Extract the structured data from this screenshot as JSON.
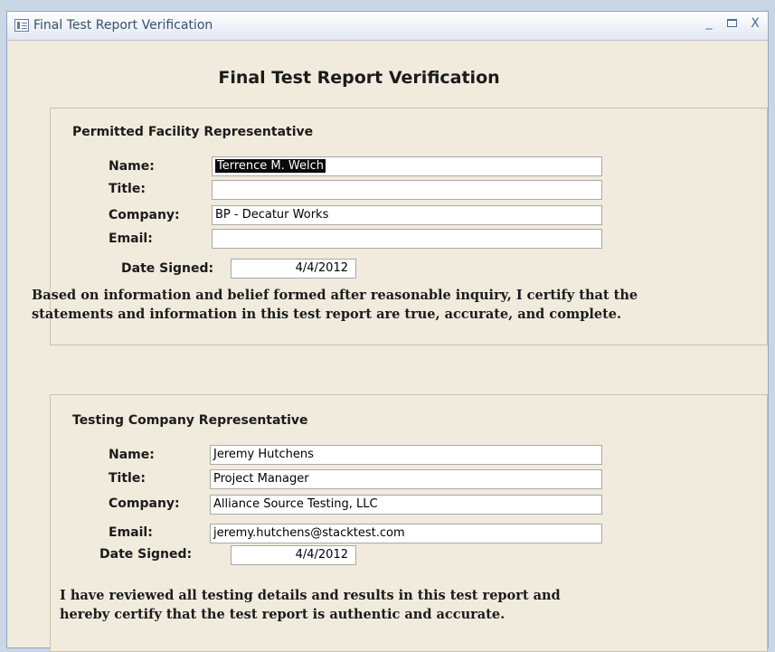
{
  "window": {
    "title": "Final Test Report Verification",
    "controls": {
      "minimize": "_",
      "close": "X"
    }
  },
  "form": {
    "heading": "Final Test Report Verification"
  },
  "facility": {
    "section_title": "Permitted Facility Representative",
    "name_label": "Name:",
    "name_value": "Terrence M. Welch",
    "title_label": "Title:",
    "title_value": "",
    "company_label": "Company:",
    "company_value": "BP - Decatur Works",
    "email_label": "Email:",
    "email_value": "",
    "date_label": "Date Signed:",
    "date_value": "4/4/2012",
    "certification_line1": "Based on information and belief formed after reasonable inquiry, I certify that the",
    "certification_line2": "statements and information in this test report are true, accurate, and complete."
  },
  "testing": {
    "section_title": "Testing Company Representative",
    "name_label": "Name:",
    "name_value": "Jeremy Hutchens",
    "title_label": "Title:",
    "title_value": "Project Manager",
    "company_label": "Company:",
    "company_value": "Alliance Source Testing, LLC",
    "email_label": "Email:",
    "email_value": "jeremy.hutchens@stacktest.com",
    "date_label": "Date Signed:",
    "date_value": "4/4/2012",
    "certification_line1": "I have reviewed all testing details and results in this test report and",
    "certification_line2": "hereby certify that the test report is authentic and accurate."
  }
}
